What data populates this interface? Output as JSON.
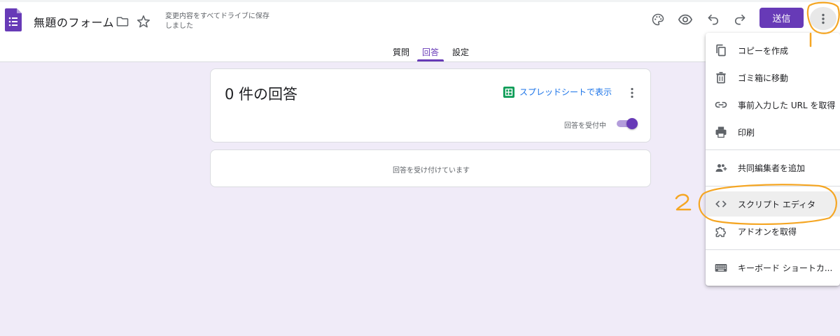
{
  "form": {
    "title": "無題のフォーム",
    "save_status": "変更内容をすべてドライブに保存しました"
  },
  "header": {
    "send_label": "送信",
    "icons": [
      "palette-icon",
      "eye-icon",
      "undo-icon",
      "redo-icon",
      "more-vert-icon"
    ]
  },
  "tabs": [
    {
      "label": "質問",
      "active": false
    },
    {
      "label": "回答",
      "active": true
    },
    {
      "label": "設定",
      "active": false
    }
  ],
  "responses": {
    "title": "0 件の回答",
    "sheets_link": "スプレッドシートで表示",
    "accepting_label": "回答を受付中",
    "accepting": true,
    "status_text": "回答を受け付けています"
  },
  "menu": {
    "items": [
      {
        "label": "コピーを作成",
        "icon": "copy-icon"
      },
      {
        "label": "ゴミ箱に移動",
        "icon": "trash-icon"
      },
      {
        "label": "事前入力した URL を取得",
        "icon": "link-icon"
      },
      {
        "label": "印刷",
        "icon": "print-icon"
      },
      {
        "label": "共同編集者を追加",
        "icon": "add-people-icon"
      },
      {
        "label": "スクリプト エディタ",
        "icon": "code-icon"
      },
      {
        "label": "アドオンを取得",
        "icon": "puzzle-icon"
      },
      {
        "label": "キーボード ショートカ...",
        "icon": "keyboard-icon"
      }
    ]
  },
  "annotations": {
    "step1": "1",
    "step2": "2",
    "color": "#f5a623"
  },
  "colors": {
    "accent": "#673ab7",
    "background": "#f0ebf8",
    "link": "#1a73e8",
    "sheets": "#0f9d58"
  }
}
